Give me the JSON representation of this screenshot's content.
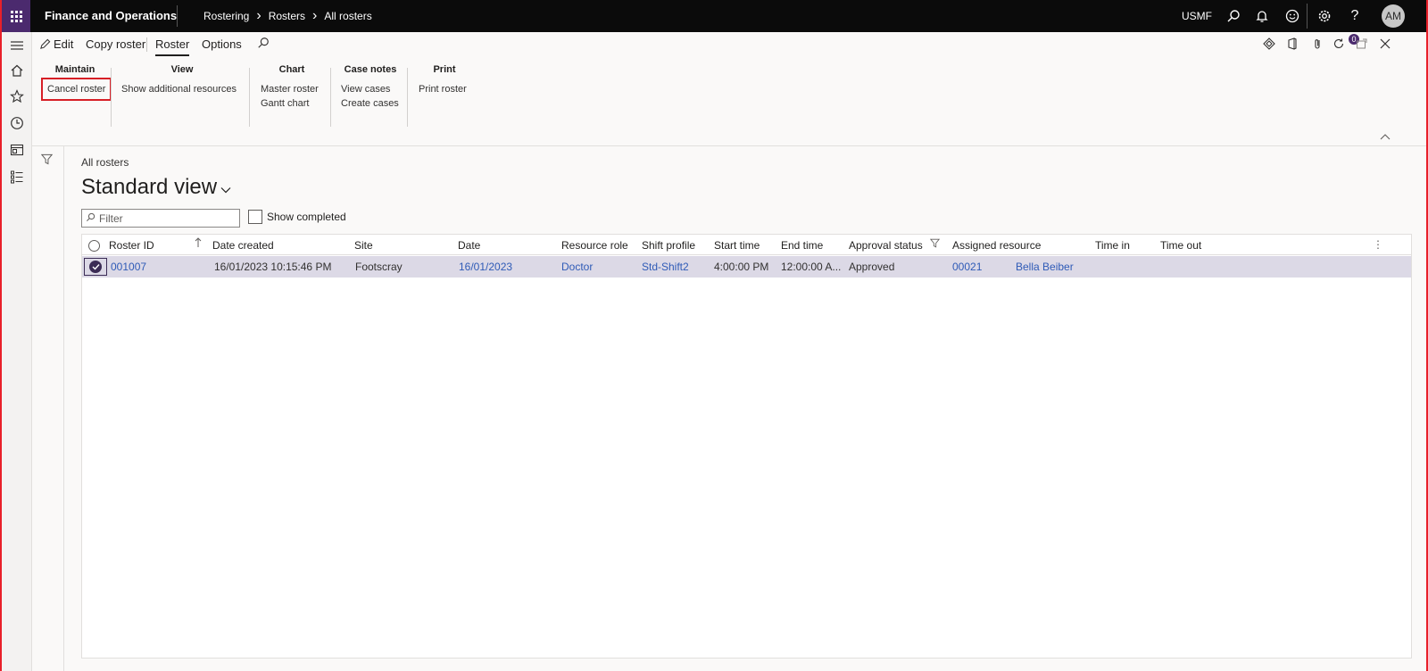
{
  "topbar": {
    "app_title": "Finance and Operations",
    "breadcrumb": [
      "Rostering",
      "Rosters",
      "All rosters"
    ],
    "company": "USMF",
    "avatar_initials": "AM",
    "icons": [
      "waffle-icon",
      "search-icon",
      "bell-icon",
      "smiley-icon",
      "gear-icon",
      "help-icon"
    ]
  },
  "actionbar": {
    "edit": "Edit",
    "copy_roster": "Copy roster",
    "tabs": [
      "Roster",
      "Options"
    ],
    "selected_tab": "Roster",
    "attachment_count": "0"
  },
  "ribbon": {
    "groups": [
      {
        "title": "Maintain",
        "items": [
          "Cancel roster"
        ]
      },
      {
        "title": "View",
        "items": [
          "Show additional resources"
        ]
      },
      {
        "title": "Chart",
        "items": [
          "Master roster",
          "Gantt chart"
        ]
      },
      {
        "title": "Case notes",
        "items": [
          "View cases",
          "Create cases"
        ]
      },
      {
        "title": "Print",
        "items": [
          "Print roster"
        ]
      }
    ]
  },
  "content": {
    "caption": "All rosters",
    "view_name": "Standard view",
    "filter_placeholder": "Filter",
    "show_completed": "Show completed"
  },
  "grid": {
    "columns": [
      "Roster ID",
      "Date created",
      "Site",
      "Date",
      "Resource role",
      "Shift profile",
      "Start time",
      "End time",
      "Approval status",
      "Assigned resource",
      "Time in",
      "Time out"
    ],
    "rows": [
      {
        "roster_id": "001007",
        "date_created": "16/01/2023 10:15:46 PM",
        "site": "Footscray",
        "date": "16/01/2023",
        "resource_role": "Doctor",
        "shift_profile": "Std-Shift2",
        "start_time": "4:00:00 PM",
        "end_time": "12:00:00 A...",
        "approval_status": "Approved",
        "assigned_resource_id": "00021",
        "assigned_resource_name": "Bella Beiber",
        "time_in": "",
        "time_out": ""
      }
    ]
  }
}
